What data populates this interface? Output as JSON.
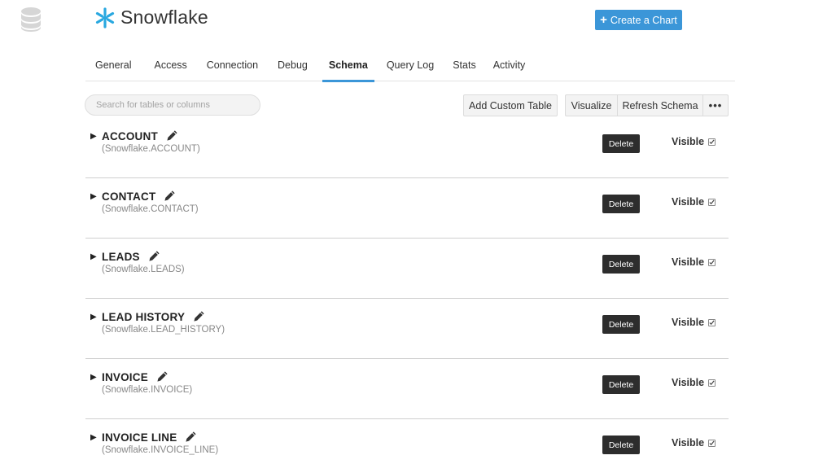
{
  "app": {
    "name": "Snowflake"
  },
  "header": {
    "create_label": "Create a Chart"
  },
  "tabs": [
    {
      "label": "General",
      "active": false
    },
    {
      "label": "Access",
      "active": false
    },
    {
      "label": "Connection",
      "active": false
    },
    {
      "label": "Debug",
      "active": false
    },
    {
      "label": "Schema",
      "active": true
    },
    {
      "label": "Query Log",
      "active": false
    },
    {
      "label": "Stats",
      "active": false
    },
    {
      "label": "Activity",
      "active": false
    }
  ],
  "toolbar": {
    "search_placeholder": "Search for tables or columns",
    "add_custom_label": "Add Custom Table",
    "visualize_label": "Visualize",
    "refresh_label": "Refresh Schema",
    "more_label": "•••"
  },
  "tables": [
    {
      "name": "ACCOUNT",
      "path": "(Snowflake.ACCOUNT)",
      "delete_label": "Delete",
      "visible_label": "Visible",
      "visible": true
    },
    {
      "name": "CONTACT",
      "path": "(Snowflake.CONTACT)",
      "delete_label": "Delete",
      "visible_label": "Visible",
      "visible": true
    },
    {
      "name": "LEADS",
      "path": "(Snowflake.LEADS)",
      "delete_label": "Delete",
      "visible_label": "Visible",
      "visible": true
    },
    {
      "name": "LEAD HISTORY",
      "path": "(Snowflake.LEAD_HISTORY)",
      "delete_label": "Delete",
      "visible_label": "Visible",
      "visible": true
    },
    {
      "name": "INVOICE",
      "path": "(Snowflake.INVOICE)",
      "delete_label": "Delete",
      "visible_label": "Visible",
      "visible": true
    },
    {
      "name": "INVOICE LINE",
      "path": "(Snowflake.INVOICE_LINE)",
      "delete_label": "Delete",
      "visible_label": "Visible",
      "visible": true
    }
  ],
  "colors": {
    "accent": "#3b96d8",
    "brand_logo": "#29a8e0",
    "delete_button": "#2d2d2d"
  },
  "icons": {
    "sidebar": "database-icon",
    "brand": "snowflake-icon",
    "row_expand": "caret-right-icon",
    "row_edit": "pencil-icon",
    "visible": "checkbox-icon"
  }
}
